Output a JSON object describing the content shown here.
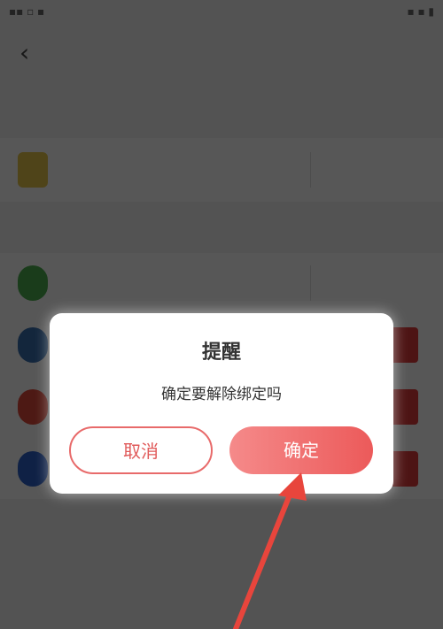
{
  "dialog": {
    "title": "提醒",
    "message": "确定要解除绑定吗",
    "cancel_label": "取消",
    "confirm_label": "确定"
  },
  "colors": {
    "accent": "#e54b4b",
    "confirm_gradient_start": "#f58a8a",
    "confirm_gradient_end": "#ec5a5a",
    "annotation_arrow": "#e8453c"
  }
}
